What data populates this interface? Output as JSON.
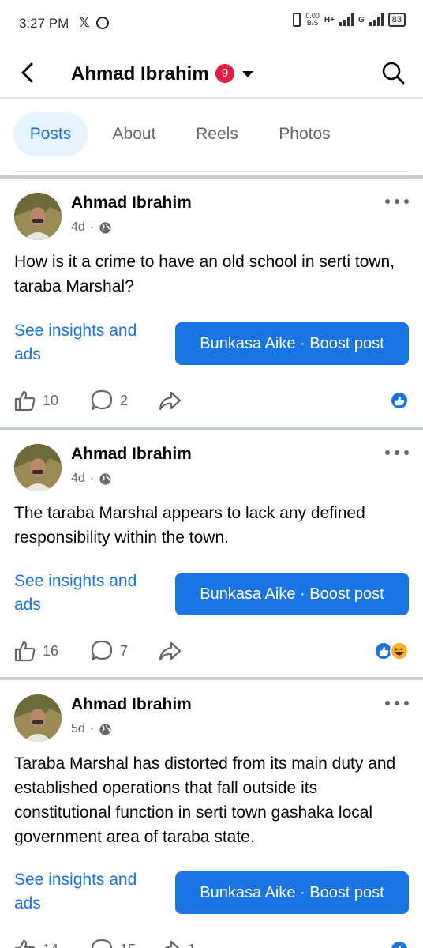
{
  "status_bar": {
    "time": "3:27 PM",
    "x_glyph": "𝕏",
    "speed_value": "0.00",
    "speed_unit": "B/S",
    "network_1": "H+",
    "network_2": "G",
    "battery": "83",
    "icons": [
      "x-icon",
      "whatsapp-icon",
      "vibrate-icon",
      "signal-icon",
      "battery-icon"
    ]
  },
  "header": {
    "title": "Ahmad Ibrahim",
    "notification_count": "9"
  },
  "tabs": [
    {
      "label": "Posts",
      "active": true
    },
    {
      "label": "About",
      "active": false
    },
    {
      "label": "Reels",
      "active": false
    },
    {
      "label": "Photos",
      "active": false
    }
  ],
  "colors": {
    "accent": "#1b74e4",
    "badge": "#e41e3f",
    "secondary_text": "#65676b"
  },
  "posts": [
    {
      "author": "Ahmad Ibrahim",
      "time": "4d",
      "text": "How is it a crime to have an old school in serti town, taraba Marshal?",
      "insights_label": "See insights and ads",
      "boost_label": "Bunkasa Aike · Boost post",
      "likes": "10",
      "comments": "2",
      "shares": "",
      "reactions": [
        "like"
      ]
    },
    {
      "author": "Ahmad Ibrahim",
      "time": "4d",
      "text": "The taraba Marshal appears to lack any defined responsibility within the town.",
      "insights_label": "See insights and ads",
      "boost_label": "Bunkasa Aike · Boost post",
      "likes": "16",
      "comments": "7",
      "shares": "",
      "reactions": [
        "like",
        "haha"
      ]
    },
    {
      "author": "Ahmad Ibrahim",
      "time": "5d",
      "text": "Taraba Marshal has distorted from its main duty and established operations that fall outside its constitutional function in serti town gashaka local government area of taraba state.",
      "insights_label": "See insights and ads",
      "boost_label": "Bunkasa Aike · Boost post",
      "likes": "14",
      "comments": "15",
      "shares": "1",
      "reactions": [
        "like"
      ]
    }
  ]
}
